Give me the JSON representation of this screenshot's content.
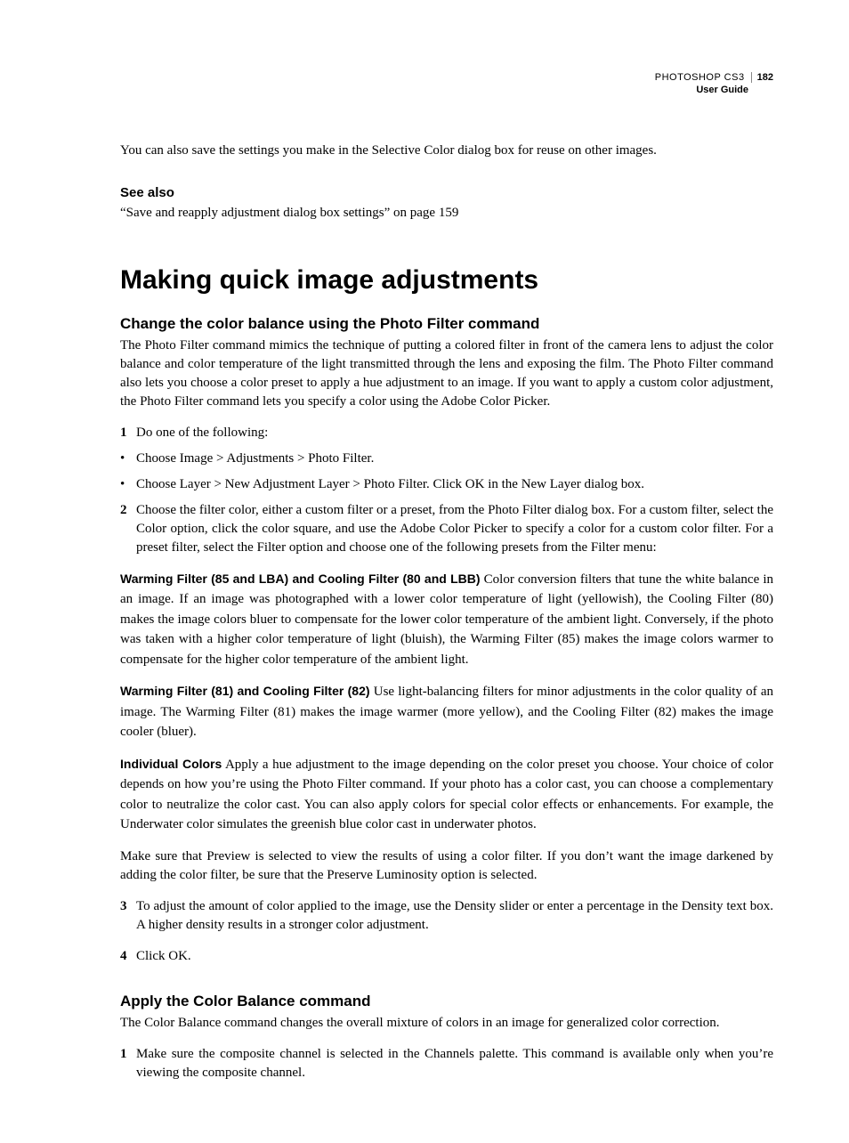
{
  "header": {
    "product": "PHOTOSHOP CS3",
    "page_number": "182",
    "subtitle": "User Guide"
  },
  "intro_para": "You can also save the settings you make in the Selective Color dialog box for reuse on other images.",
  "see_also": {
    "heading": "See also",
    "link_text": "“Save and reapply adjustment dialog box settings” on page 159"
  },
  "section": {
    "title": "Making quick image adjustments",
    "sub1": {
      "heading": "Change the color balance using the Photo Filter command",
      "para1": "The Photo Filter command mimics the technique of putting a colored filter in front of the camera lens to adjust the color balance and color temperature of the light transmitted through the lens and exposing the film. The Photo Filter command also lets you choose a color preset to apply a hue adjustment to an image. If you want to apply a custom color adjustment, the Photo Filter command lets you specify a color using the Adobe Color Picker.",
      "step1_marker": "1",
      "step1_text": "Do one of the following:",
      "bullet1": "Choose Image > Adjustments > Photo Filter.",
      "bullet2": "Choose Layer > New Adjustment Layer > Photo Filter. Click OK in the New Layer dialog box.",
      "step2_marker": "2",
      "step2_text": "Choose the filter color, either a custom filter or a preset, from the Photo Filter dialog box. For a custom filter, select the Color option, click the color square, and use the Adobe Color Picker to specify a color for a custom color filter. For a preset filter, select the Filter option and choose one of the following presets from the Filter menu:",
      "term1_label": "Warming Filter (85 and LBA) and Cooling Filter (80 and LBB)",
      "term1_text": " Color conversion filters that tune the white balance in an image. If an image was photographed with a lower color temperature of light (yellowish), the Cooling Filter (80) makes the image colors bluer to compensate for the lower color temperature of the ambient light. Conversely, if the photo was taken with a higher color temperature of light (bluish), the Warming Filter (85) makes the image colors warmer to compensate for the higher color temperature of the ambient light.",
      "term2_label": "Warming Filter (81) and Cooling Filter (82)",
      "term2_text": " Use light-balancing filters for minor adjustments in the color quality of an image. The Warming Filter (81) makes the image warmer (more yellow), and the Cooling Filter (82) makes the image cooler (bluer).",
      "term3_label": "Individual Colors",
      "term3_text": " Apply a hue adjustment to the image depending on the color preset you choose. Your choice of color depends on how you’re using the Photo Filter command. If your photo has a color cast, you can choose a complementary color to neutralize the color cast. You can also apply colors for special color effects or enhancements. For example, the Underwater color simulates the greenish blue color cast in underwater photos.",
      "para_preview": "Make sure that Preview is selected to view the results of using a color filter. If you don’t want the image darkened by adding the color filter, be sure that the Preserve Luminosity option is selected.",
      "step3_marker": "3",
      "step3_text": "To adjust the amount of color applied to the image, use the Density slider or enter a percentage in the Density text box. A higher density results in a stronger color adjustment.",
      "step4_marker": "4",
      "step4_text": "Click OK."
    },
    "sub2": {
      "heading": "Apply the Color Balance command",
      "para1": "The Color Balance command changes the overall mixture of colors in an image for generalized color correction.",
      "step1_marker": "1",
      "step1_text": "Make sure the composite channel is selected in the Channels palette. This command is available only when you’re viewing the composite channel."
    }
  }
}
